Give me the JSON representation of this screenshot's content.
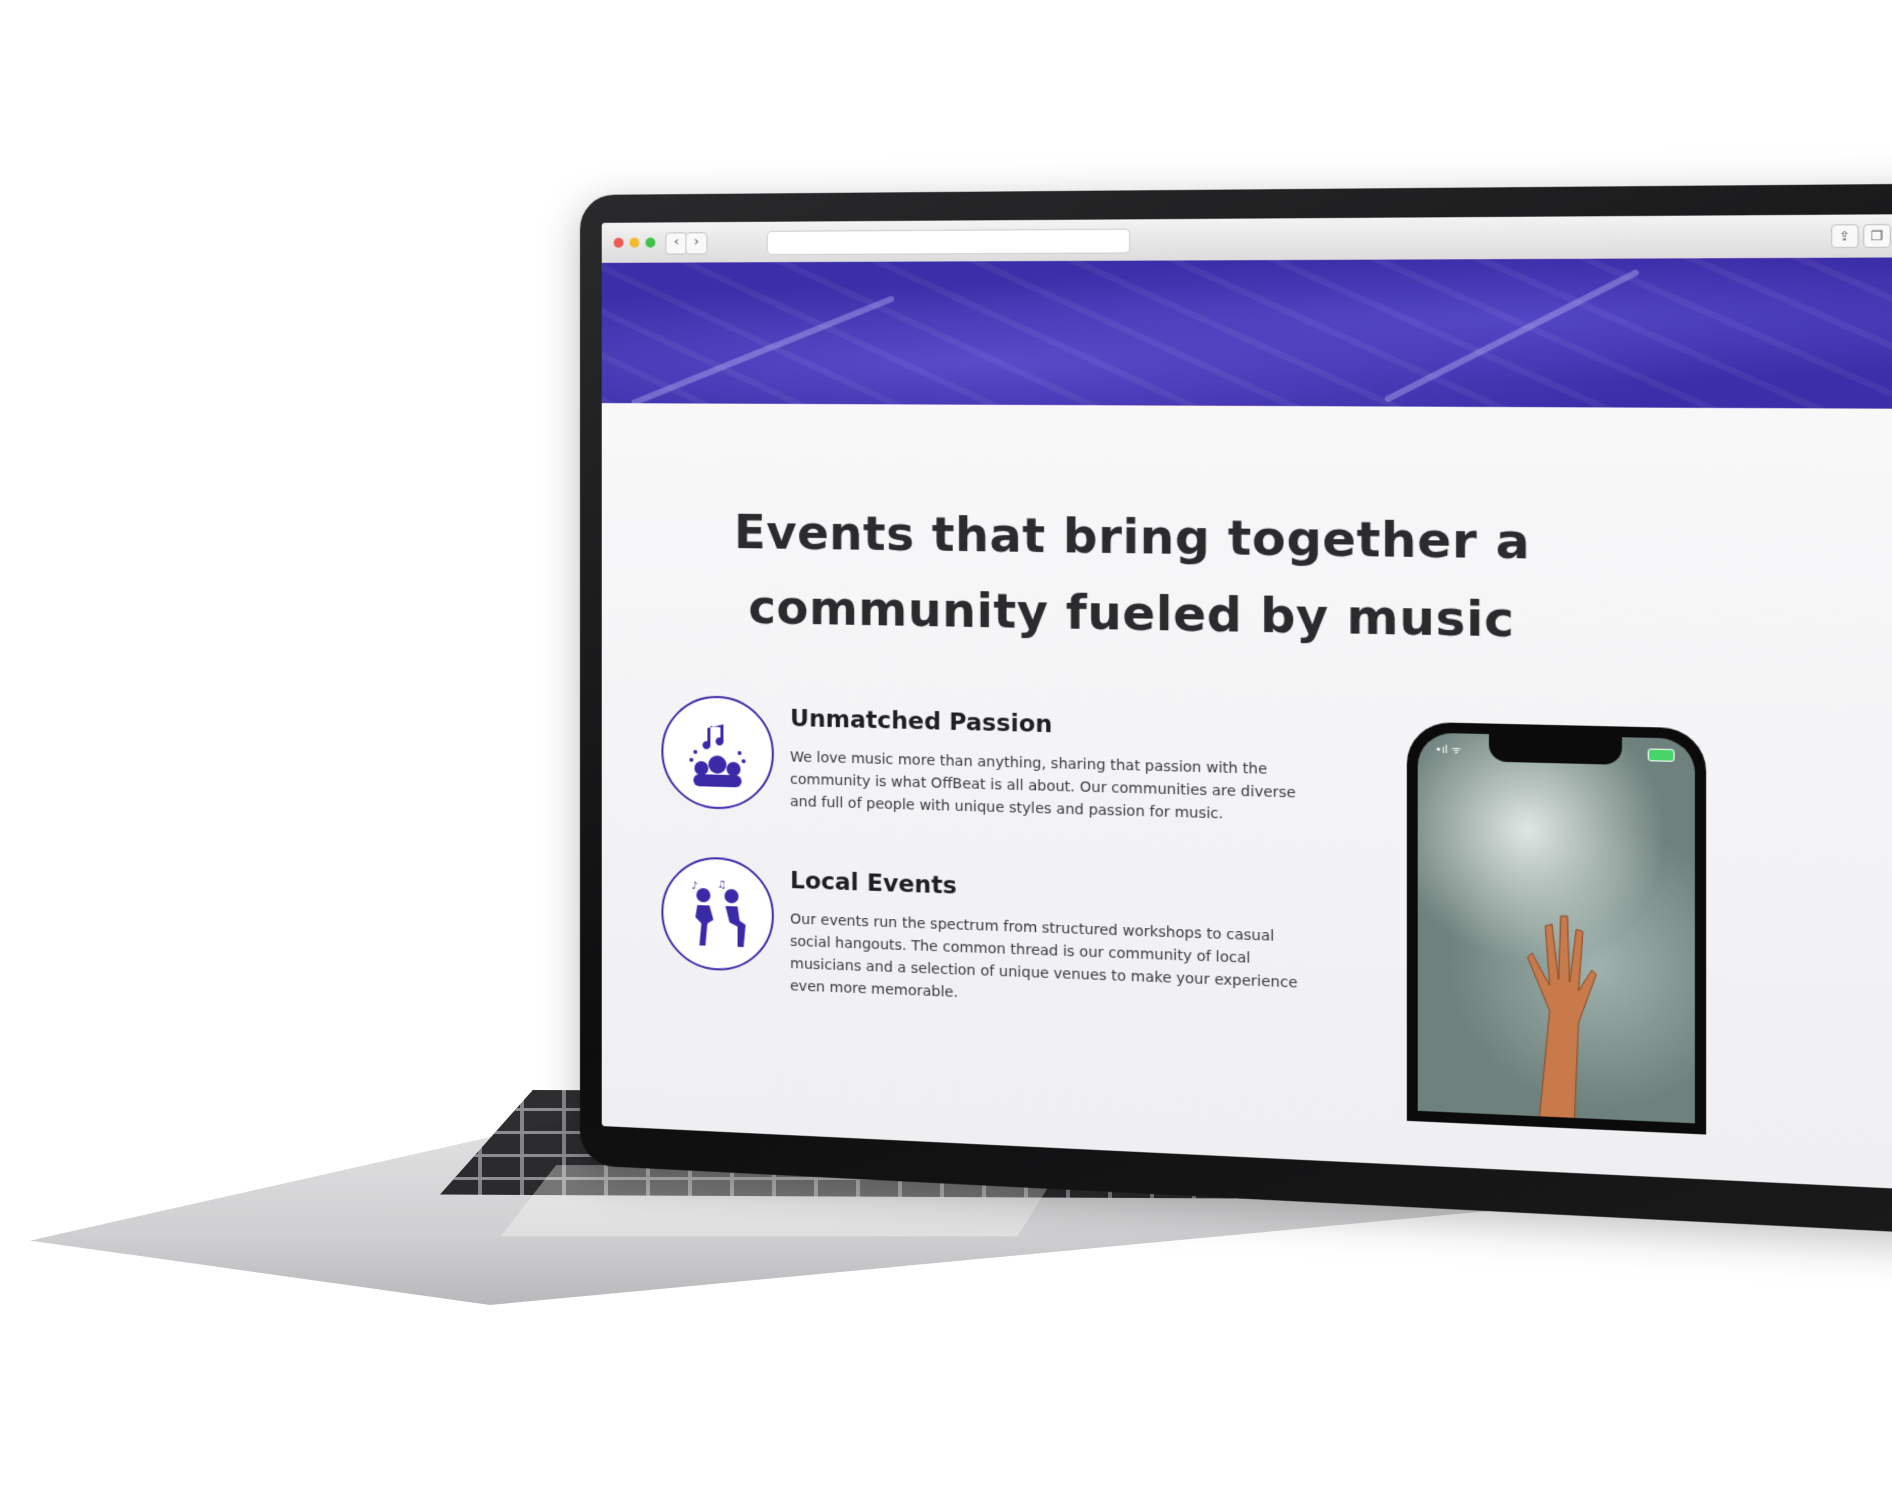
{
  "browser": {
    "back_icon": "‹",
    "forward_icon": "›",
    "share_icon": "⇪",
    "tabs_icon": "❐",
    "plus_icon": "+"
  },
  "hero": {
    "accent": "#3c2ea8"
  },
  "main": {
    "headline": "Events that bring together a community fueled by music",
    "features": [
      {
        "title": "Unmatched Passion",
        "text": "We love music more than anything, sharing that passion with the community is what OffBeat is all about. Our communities are diverse and full of people with unique styles and passion for music.",
        "icon": "music-community-icon"
      },
      {
        "title": "Local Events",
        "text": "Our events run the spectrum from structured workshops to casual social hangouts. The common thread is our community of local musicians and a selection of unique venues to make your experience even more memorable.",
        "icon": "singers-icon"
      }
    ]
  },
  "phone": {
    "status_left": "•ıl ᯤ",
    "battery_color": "#49d46a"
  }
}
